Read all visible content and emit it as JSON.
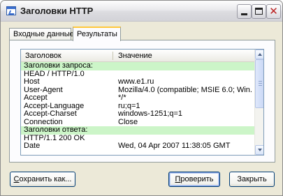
{
  "window": {
    "title": "Заголовки HTTP"
  },
  "tabs": [
    {
      "label": "Входные данные"
    },
    {
      "label": "Результаты"
    }
  ],
  "table": {
    "columns": [
      "Заголовок",
      "Значение"
    ],
    "rows": [
      {
        "type": "group",
        "key": "Заголовки запроса:",
        "value": ""
      },
      {
        "type": "row",
        "key": "HEAD / HTTP/1.0",
        "value": ""
      },
      {
        "type": "row",
        "key": "Host",
        "value": "www.e1.ru"
      },
      {
        "type": "row",
        "key": "User-Agent",
        "value": "Mozilla/4.0 (compatible; MSIE 6.0; Win..."
      },
      {
        "type": "row",
        "key": "Accept",
        "value": "*/*"
      },
      {
        "type": "row",
        "key": "Accept-Language",
        "value": "ru;q=1"
      },
      {
        "type": "row",
        "key": "Accept-Charset",
        "value": "windows-1251;q=1"
      },
      {
        "type": "row",
        "key": "Connection",
        "value": "Close"
      },
      {
        "type": "group",
        "key": "Заголовки ответа:",
        "value": ""
      },
      {
        "type": "row",
        "key": "HTTP/1.1 200 OK",
        "value": ""
      },
      {
        "type": "row",
        "key": "Date",
        "value": "Wed, 04 Apr 2007 11:38:05 GMT"
      }
    ]
  },
  "buttons": {
    "save": {
      "pre": "",
      "key": "С",
      "post": "охранить как..."
    },
    "check": {
      "pre": "",
      "key": "П",
      "post": "роверить"
    },
    "close": {
      "label": "Закрыть"
    }
  },
  "colors": {
    "group_row": "#ccf5c8",
    "tab_accent": "#ffc83c"
  }
}
